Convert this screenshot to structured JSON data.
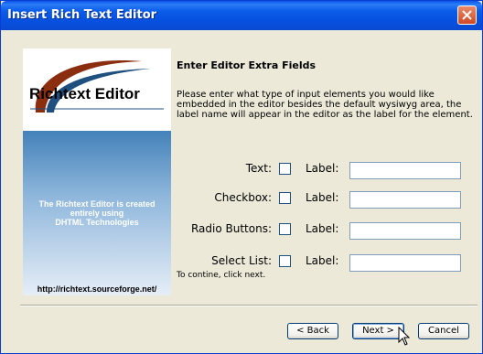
{
  "window": {
    "title": "Insert Rich Text Editor"
  },
  "panel": {
    "logo_text": "Richtext Editor",
    "promo_lines": [
      "The Richtext Editor is created",
      "entirely using",
      "DHTML Technologies"
    ],
    "url": "http://richtext.sourceforge.net/"
  },
  "content": {
    "heading": "Enter Editor Extra Fields",
    "description": "Please enter what type of input elements you would like embedded in the editor besides the default wysiwyg area, the label name will appear in the editor as the label for the element.",
    "fields": [
      {
        "name": "Text:",
        "label": "Label:",
        "checked": false,
        "value": ""
      },
      {
        "name": "Checkbox:",
        "label": "Label:",
        "checked": false,
        "value": ""
      },
      {
        "name": "Radio Buttons:",
        "label": "Label:",
        "checked": false,
        "value": ""
      },
      {
        "name": "Select List:",
        "label": "Label:",
        "checked": false,
        "value": ""
      }
    ],
    "hint": "To contine, click next."
  },
  "buttons": {
    "back": "< Back",
    "next": "Next >",
    "cancel": "Cancel"
  },
  "colors": {
    "titlebar": "#0a55ea",
    "panel_top": "#1f5a8a",
    "swoosh": "#8b2e10"
  }
}
